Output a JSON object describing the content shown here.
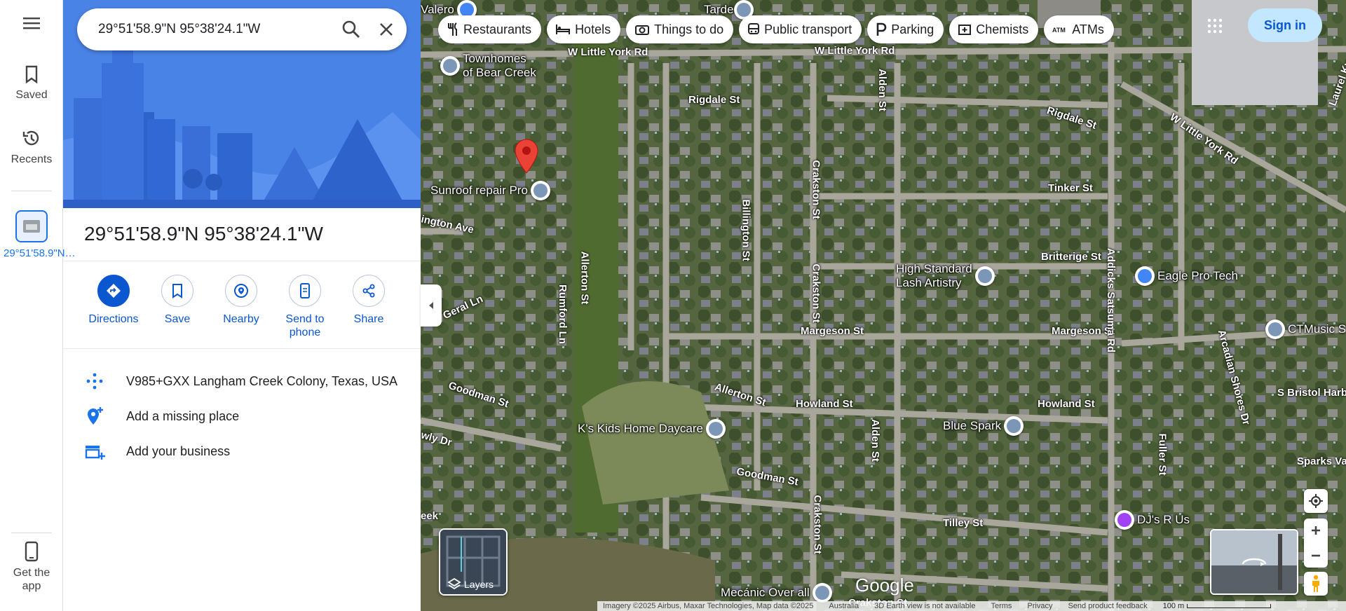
{
  "search": {
    "value": "29°51'58.9\"N 95°38'24.1\"W"
  },
  "rail": {
    "saved": "Saved",
    "recents": "Recents",
    "recent_place": "29°51'58.9\"N…",
    "get_app": "Get the app"
  },
  "place": {
    "title": "29°51'58.9\"N 95°38'24.1\"W",
    "plus_code": "V985+GXX Langham Creek Colony, Texas, USA",
    "add_missing": "Add a missing place",
    "add_business": "Add your business"
  },
  "actions": {
    "directions": "Directions",
    "save": "Save",
    "nearby": "Nearby",
    "send_to_phone": "Send to phone",
    "share": "Share"
  },
  "chips": [
    "Restaurants",
    "Hotels",
    "Things to do",
    "Public transport",
    "Parking",
    "Chemists",
    "ATMs"
  ],
  "sign_in": "Sign in",
  "layers": "Layers",
  "logo": "Google",
  "streets": [
    "W Little York Rd",
    "W Little York Rd",
    "Rigdale St",
    "Rigdale St",
    "W Little York Rd",
    "Tinker St",
    "Britterige St",
    "Margeson St",
    "Margeson St",
    "Howland St",
    "Howland St",
    "Allerton St",
    "Allerton St",
    "Goodman St",
    "Goodman St",
    "Tilley St",
    "Geral Ln",
    "ington Ave",
    "Rumford Ln",
    "Billington St",
    "Crakston St",
    "Crakston St",
    "Crakston St",
    "Crakston St",
    "Alden St",
    "Alden St",
    "Addicks Satsuma Rd",
    "Fuller St",
    "Arcadian Shores Dr",
    "S Bristol Harb",
    "Sparks Va",
    "Laurel Ky",
    "wly Dr",
    "Crakston St",
    "eek",
    "Alden St"
  ],
  "pois": [
    {
      "label": "Townhomes\nof Bear Creek",
      "icon": "building-icon"
    },
    {
      "label": "Sunroof repair Pro",
      "icon": "repair-icon"
    },
    {
      "label": "High Standard\nLash Artistry",
      "icon": "beauty-icon"
    },
    {
      "label": "Eagle Pro Tech",
      "icon": "store-icon"
    },
    {
      "label": "CTMusic S",
      "icon": "music-icon"
    },
    {
      "label": "Blue Spark",
      "icon": "store-icon"
    },
    {
      "label": "K's Kids Home Daycare",
      "icon": "daycare-icon"
    },
    {
      "label": "DJ's R Us",
      "icon": "music-icon"
    },
    {
      "label": "Mecánic Over all",
      "icon": "repair-icon"
    },
    {
      "label": "Valero",
      "icon": "fuel-icon"
    },
    {
      "label": "Tarde",
      "icon": "store-icon"
    }
  ],
  "footer": {
    "imagery": "Imagery ©2025 Airbus, Maxar Technologies, Map data ©2025",
    "region": "Australia",
    "earth": "3D Earth view is not available",
    "terms": "Terms",
    "privacy": "Privacy",
    "feedback": "Send product feedback",
    "scale": "100 m"
  },
  "colors": {
    "accent": "#0b57d0",
    "hero": "#4a83e6",
    "marker": "#ea4335",
    "signin_bg": "#c2e7ff"
  }
}
